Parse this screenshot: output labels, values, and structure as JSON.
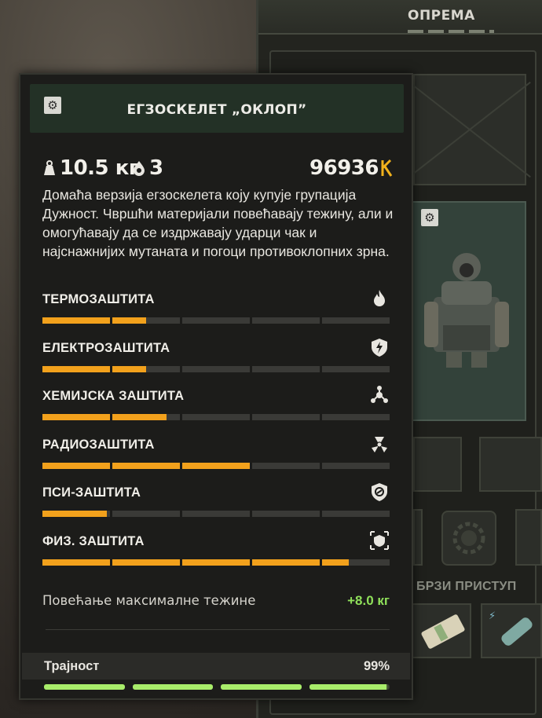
{
  "equipment": {
    "title": "ОПРЕМА",
    "quick_access_label": "БРЗИ ПРИСТУП"
  },
  "item": {
    "title": "ЕГЗОСКЕЛЕТ „ОКЛОП”",
    "weight": "10.5 кг",
    "slots": "3",
    "price": "96936",
    "description": "Домаћа верзија егзоскелета коју купује групација Дужност. Чвршћи материјали повећавају тежину, али и омогућавају да се издржавају ударци чак и најснажнијих мутаната и погоци противоклопних зрна."
  },
  "protections": [
    {
      "label": "ТЕРМОЗАШТИТА",
      "icon": "fire-icon",
      "level": 0.3
    },
    {
      "label": "ЕЛЕКТРОЗАШТИТА",
      "icon": "lightning-shield-icon",
      "level": 0.3
    },
    {
      "label": "ХЕМИЈСКА ЗАШТИТА",
      "icon": "chemical-icon",
      "level": 0.36
    },
    {
      "label": "РАДИОЗАШТИТА",
      "icon": "radiation-icon",
      "level": 0.6
    },
    {
      "label": "ПСИ-ЗАШТИТА",
      "icon": "psi-shield-icon",
      "level": 0.19
    },
    {
      "label": "ФИЗ. ЗАШТИТА",
      "icon": "physical-armor-icon",
      "level": 0.88
    }
  ],
  "weight_bonus": {
    "label": "Повећање максималне тежине",
    "value": "+8.0 кг"
  },
  "durability": {
    "label": "Трајност",
    "value": "99%",
    "level": 0.99
  },
  "colors": {
    "accent_orange": "#f2a11c",
    "accent_green": "#8fe05a",
    "header_green": "#233126"
  }
}
